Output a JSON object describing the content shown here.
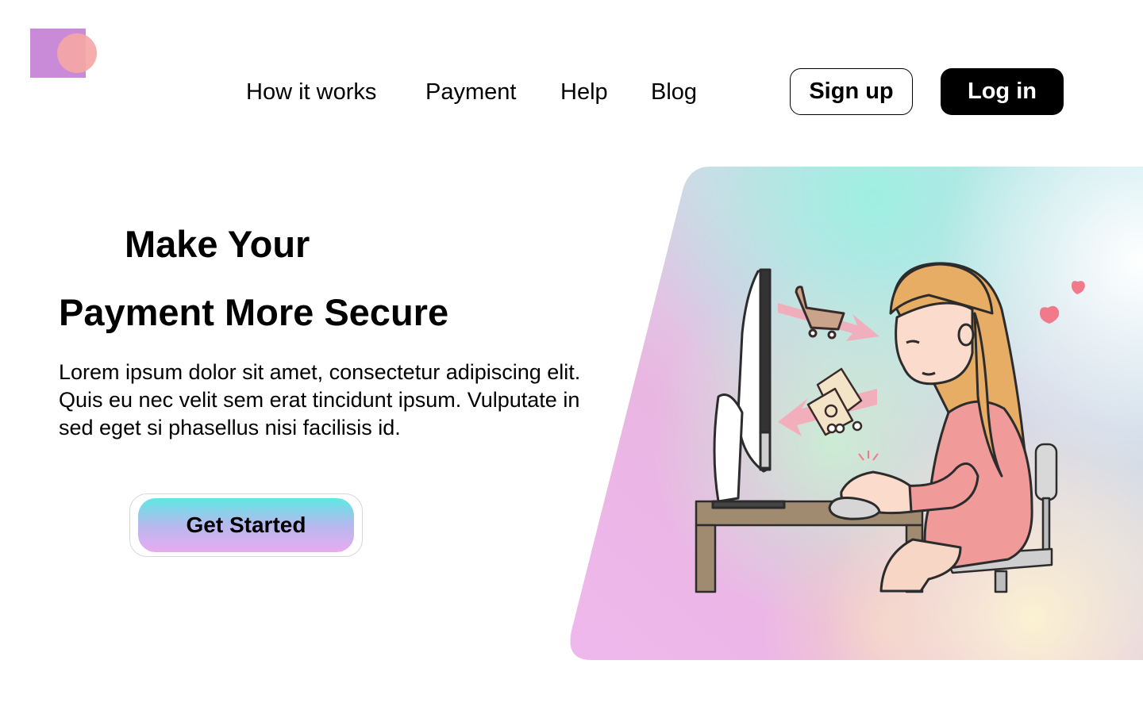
{
  "nav": {
    "items": [
      "How it works",
      "Payment",
      "Help",
      "Blog"
    ]
  },
  "auth": {
    "signup_label": "Sign up",
    "login_label": "Log in"
  },
  "hero": {
    "title_line1": "Make Your",
    "title_line2": "Payment More Secure",
    "description": "Lorem ipsum dolor sit amet, consectetur adipiscing elit. Quis eu nec velit sem erat tincidunt ipsum. Vulputate in sed eget si  phasellus nisi facilisis id.",
    "cta_label": "Get Started"
  },
  "colors": {
    "logo_square": "#c98ad8",
    "logo_circle": "#f4a6a6",
    "button_dark": "#000000",
    "cta_gradient_top": "#5fe8e4",
    "cta_gradient_bottom": "#e8aaf0",
    "panel_teal": "#a8f0e6",
    "panel_pink": "#eab8ec",
    "panel_cream": "#fbf2d8"
  }
}
